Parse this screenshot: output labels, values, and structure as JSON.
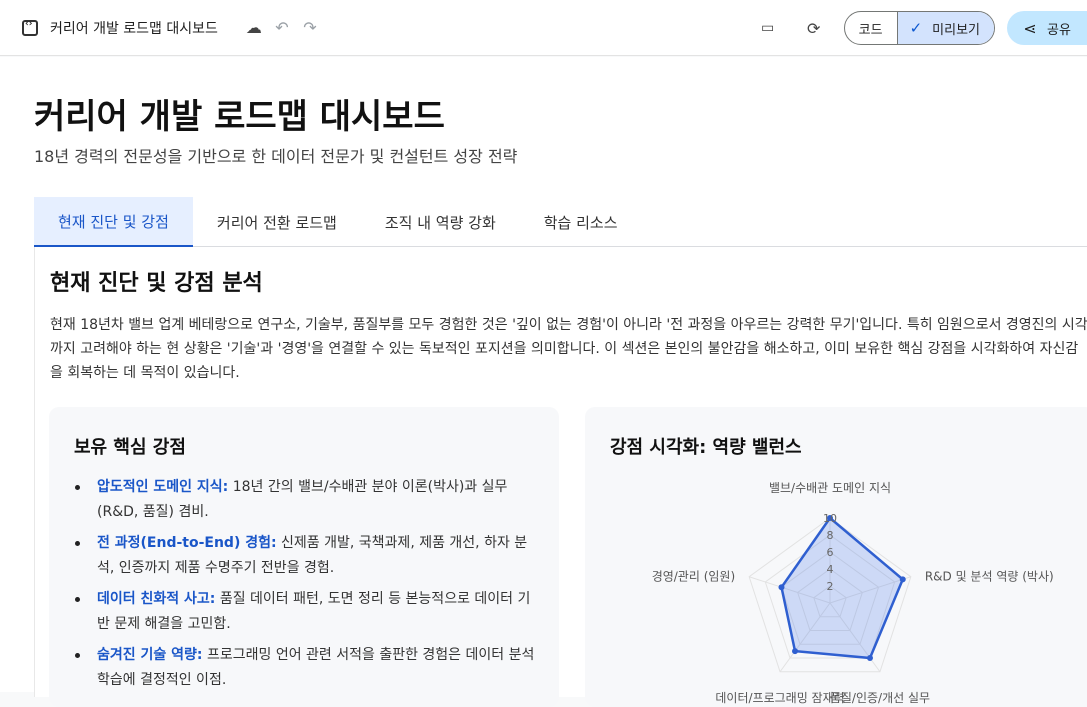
{
  "topbar": {
    "title": "커리어 개발 로드맵 대시보드",
    "code_label": "코드",
    "preview_label": "미리보기",
    "share_label": "공유"
  },
  "page": {
    "title": "커리어 개발 로드맵 대시보드",
    "subtitle": "18년 경력의 전문성을 기반으로 한 데이터 전문가 및 컨설턴트 성장 전략"
  },
  "tabs": [
    {
      "label": "현재 진단 및 강점"
    },
    {
      "label": "커리어 전환 로드맵"
    },
    {
      "label": "조직 내 역량 강화"
    },
    {
      "label": "학습 리소스"
    }
  ],
  "section": {
    "title": "현재 진단 및 강점 분석",
    "description": "현재 18년차 밸브 업계 베테랑으로 연구소, 기술부, 품질부를 모두 경험한 것은 '깊이 없는 경험'이 아니라 '전 과정을 아우르는 강력한 무기'입니다. 특히 임원으로서 경영진의 시각까지 고려해야 하는 현 상황은 '기술'과 '경영'을 연결할 수 있는 독보적인 포지션을 의미합니다. 이 섹션은 본인의 불안감을 해소하고, 이미 보유한 핵심 강점을 시각화하여 자신감을 회복하는 데 목적이 있습니다."
  },
  "strengths": {
    "title": "보유 핵심 강점",
    "items": [
      {
        "label": "압도적인 도메인 지식:",
        "text": " 18년 간의 밸브/수배관 분야 이론(박사)과 실무(R&D, 품질) 겸비."
      },
      {
        "label": "전 과정(End-to-End) 경험:",
        "text": " 신제품 개발, 국책과제, 제품 개선, 하자 분석, 인증까지 제품 수명주기 전반을 경험."
      },
      {
        "label": "데이터 친화적 사고:",
        "text": " 품질 데이터 패턴, 도면 정리 등 본능적으로 데이터 기반 문제 해결을 고민함."
      },
      {
        "label": "숨겨진 기술 역량:",
        "text": " 프로그래밍 언어 관련 서적을 출판한 경험은 데이터 분석 학습에 결정적인 이점."
      }
    ]
  },
  "chart_data": {
    "type": "radar",
    "title": "강점 시각화: 역량 밸런스",
    "axes": [
      "밸브/수배관 도메인 지식",
      "R&D 및 분석 역량 (박사)",
      "품질/인증/개선 실무",
      "데이터/프로그래밍 잠재력",
      "경영/관리 (임원)"
    ],
    "ticks": [
      "2",
      "4",
      "6",
      "8",
      "10"
    ],
    "range": [
      0,
      10
    ],
    "values": [
      10,
      9,
      8,
      7,
      6
    ],
    "colors": {
      "fill": "rgba(59,108,230,0.22)",
      "stroke": "#2f5fd0"
    }
  }
}
